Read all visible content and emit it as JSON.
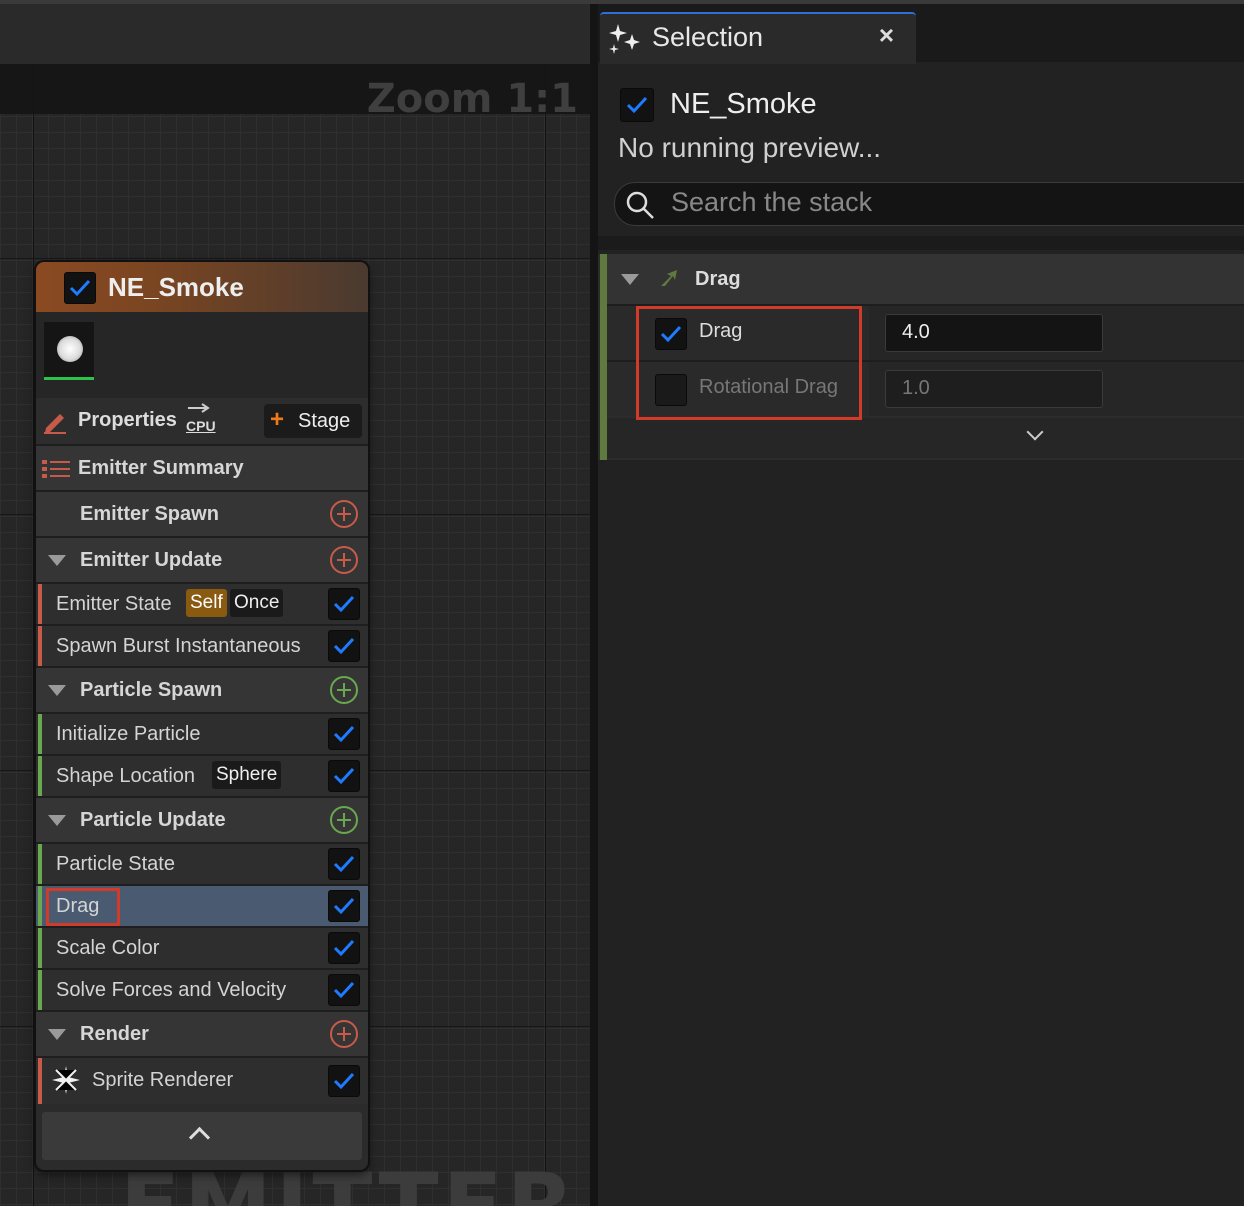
{
  "graph": {
    "zoom_label": "Zoom 1:1",
    "watermark": "EMITTER"
  },
  "emitter_node": {
    "name": "NE_Smoke",
    "enabled": true,
    "properties_label": "Properties",
    "sim_target": "CPU",
    "stage_button": "Stage",
    "summary_label": "Emitter Summary",
    "sections": {
      "emitter_spawn": "Emitter Spawn",
      "emitter_update": "Emitter Update",
      "particle_spawn": "Particle Spawn",
      "particle_update": "Particle Update",
      "render": "Render"
    },
    "modules": {
      "emitter_state": {
        "label": "Emitter State",
        "tag1": "Self",
        "tag2": "Once"
      },
      "spawn_burst": {
        "label": "Spawn Burst Instantaneous"
      },
      "initialize_particle": {
        "label": "Initialize Particle"
      },
      "shape_location": {
        "label": "Shape Location",
        "tag": "Sphere"
      },
      "particle_state": {
        "label": "Particle State"
      },
      "drag": {
        "label": "Drag"
      },
      "scale_color": {
        "label": "Scale Color"
      },
      "solve_forces": {
        "label": "Solve Forces and Velocity"
      },
      "sprite_renderer": {
        "label": "Sprite Renderer"
      }
    }
  },
  "selection_panel": {
    "tab_title": "Selection",
    "emitter_name": "NE_Smoke",
    "status": "No running preview...",
    "search_placeholder": "Search the stack",
    "module_title": "Drag",
    "params": [
      {
        "label": "Drag",
        "value": "4.0",
        "enabled": true
      },
      {
        "label": "Rotational Drag",
        "value": "1.0",
        "enabled": false
      }
    ]
  },
  "colors": {
    "emitter_accent": "#c85a4a",
    "particle_accent": "#6aa84f",
    "checkbox_blue": "#1e7bff",
    "highlight_red": "#d23a2a",
    "selected_row": "#4a5a70"
  }
}
